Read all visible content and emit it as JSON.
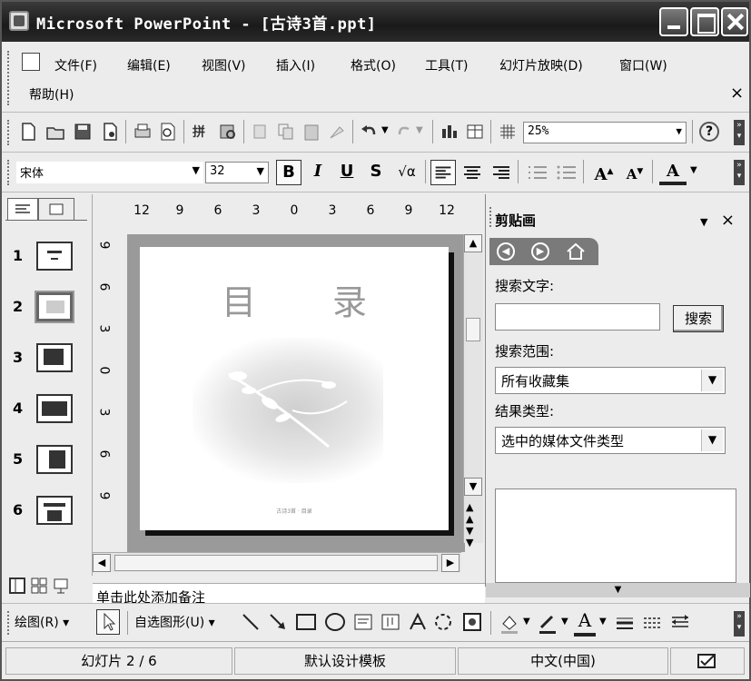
{
  "window": {
    "title": "Microsoft PowerPoint - [古诗3首.ppt]"
  },
  "menu": {
    "items": [
      "文件(F)",
      "编辑(E)",
      "视图(V)",
      "插入(I)",
      "格式(O)",
      "工具(T)",
      "幻灯片放映(D)",
      "窗口(W)"
    ],
    "help": "帮助(H)",
    "close": "×"
  },
  "standard_toolbar": {
    "zoom": "25%",
    "help_icon": "?"
  },
  "format_toolbar": {
    "font": "宋体",
    "size": "32",
    "bold": "B",
    "italic": "I",
    "underline": "U",
    "shadow": "S",
    "equation": "√α",
    "increase_font": "A",
    "decrease_font": "A",
    "font_color": "A"
  },
  "outline_pane": {
    "slides": [
      "1",
      "2",
      "3",
      "4",
      "5",
      "6"
    ],
    "selected_index": 2
  },
  "ruler": {
    "horizontal": [
      "12",
      "9",
      "6",
      "3",
      "0",
      "3",
      "6",
      "9",
      "12"
    ],
    "vertical": [
      "9",
      "6",
      "3",
      "0",
      "3",
      "6",
      "9"
    ]
  },
  "slide": {
    "title": "目 录",
    "footer": "古诗3首 · 目录"
  },
  "task_pane": {
    "title": "剪贴画",
    "close": "×",
    "search_text_label": "搜索文字:",
    "search_text_value": "",
    "search_button": "搜索",
    "search_scope_label": "搜索范围:",
    "search_scope_value": "所有收藏集",
    "result_type_label": "结果类型:",
    "result_type_value": "选中的媒体文件类型"
  },
  "notes": {
    "placeholder": "单击此处添加备注"
  },
  "draw_toolbar": {
    "draw": "绘图(R)",
    "autoshapes": "自选图形(U)"
  },
  "statusbar": {
    "slide_info": "幻灯片 2 / 6",
    "template": "默认设计模板",
    "language": "中文(中国)"
  }
}
